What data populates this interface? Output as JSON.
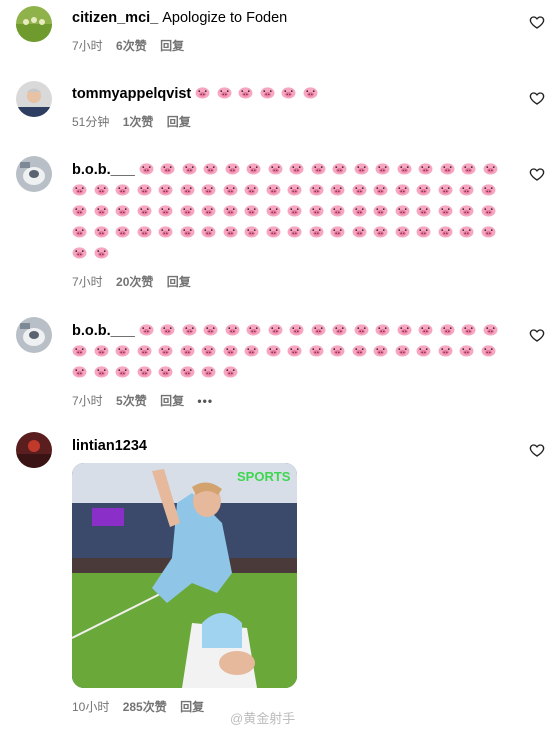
{
  "comments": [
    {
      "user": "citizen_mci_",
      "text": "Apologize to Foden",
      "pigs": 0,
      "time": "7小时",
      "likes": "6次赞",
      "reply": "回复"
    },
    {
      "user": "tommyappelqvist",
      "text": "",
      "pigs": 6,
      "time": "51分钟",
      "likes": "1次赞",
      "reply": "回复"
    },
    {
      "user": "b.o.b.___",
      "text": "",
      "pigs": 79,
      "time": "7小时",
      "likes": "20次赞",
      "reply": "回复"
    },
    {
      "user": "b.o.b.___",
      "text": "",
      "pigs": 45,
      "time": "7小时",
      "likes": "5次赞",
      "reply": "回复",
      "more": "•••"
    },
    {
      "user": "lintian1234",
      "text": "",
      "pigs": 0,
      "time": "10小时",
      "likes": "285次赞",
      "reply": "回复",
      "gif_logo": "SPORTS"
    }
  ],
  "watermark": "@黄金射手",
  "icons": {
    "like": "heart-outline-icon",
    "pig": "pig-face-emoji",
    "more": "more-dots-icon"
  },
  "colors": {
    "meta_text": "#737373",
    "pig_pink": "#f48fb1",
    "pitch": "#6aa83a",
    "kit": "#8fc6e8"
  }
}
